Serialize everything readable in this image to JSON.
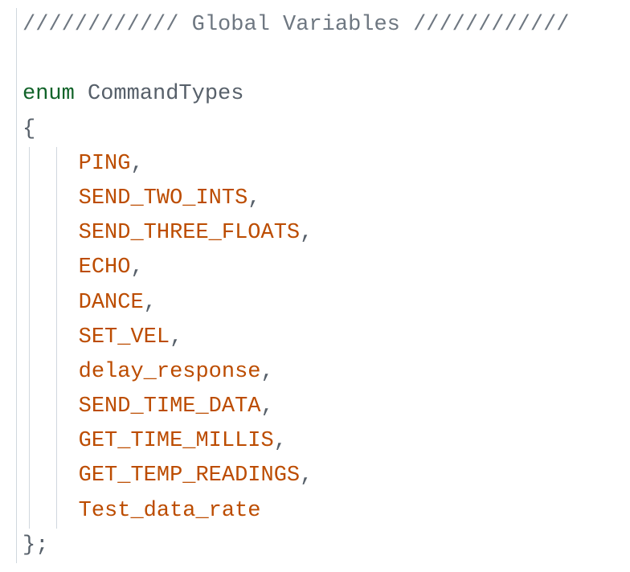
{
  "comment_line": "//////////// Global Variables ////////////",
  "enum_keyword": "enum",
  "enum_name": " CommandTypes",
  "brace_open": "{",
  "brace_close": "};",
  "members": [
    {
      "name": "PING",
      "comma": ","
    },
    {
      "name": "SEND_TWO_INTS",
      "comma": ","
    },
    {
      "name": "SEND_THREE_FLOATS",
      "comma": ","
    },
    {
      "name": "ECHO",
      "comma": ","
    },
    {
      "name": "DANCE",
      "comma": ","
    },
    {
      "name": "SET_VEL",
      "comma": ","
    },
    {
      "name": "delay_response",
      "comma": ","
    },
    {
      "name": "SEND_TIME_DATA",
      "comma": ","
    },
    {
      "name": "GET_TIME_MILLIS",
      "comma": ","
    },
    {
      "name": "GET_TEMP_READINGS",
      "comma": ","
    },
    {
      "name": "Test_data_rate",
      "comma": ""
    }
  ]
}
